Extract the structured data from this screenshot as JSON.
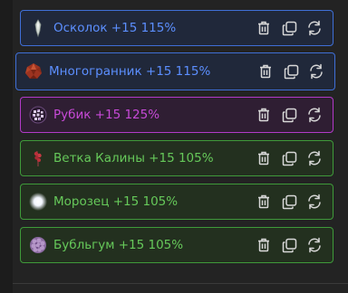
{
  "colors": {
    "blue_border": "#3f6fd6",
    "blue_bg": "#20283a",
    "blue_text": "#5c8fff",
    "purple_border": "#b23ac8",
    "purple_bg": "#2f1e33",
    "purple_text": "#c84ad8",
    "green_border": "#3f9a3a",
    "green_bg": "#23301f",
    "green_text": "#66c95a",
    "icon": "#d8d8d8"
  },
  "items": [
    {
      "label": "Осколок +15 115%",
      "tier": "blue",
      "thumb": "shard-icon"
    },
    {
      "label": "Многогранник +15 115%",
      "tier": "blue",
      "thumb": "polyhedron-icon"
    },
    {
      "label": "Рубик +15 125%",
      "tier": "purple",
      "thumb": "rubik-icon"
    },
    {
      "label": "Ветка Калины +15 105%",
      "tier": "green",
      "thumb": "viburnum-branch-icon"
    },
    {
      "label": "Морозец +15 105%",
      "tier": "green",
      "thumb": "frost-icon"
    },
    {
      "label": "Бубльгум +15 105%",
      "tier": "green",
      "thumb": "bubblegum-icon"
    }
  ],
  "actions": [
    "trash-icon",
    "copy-icon",
    "refresh-icon"
  ]
}
